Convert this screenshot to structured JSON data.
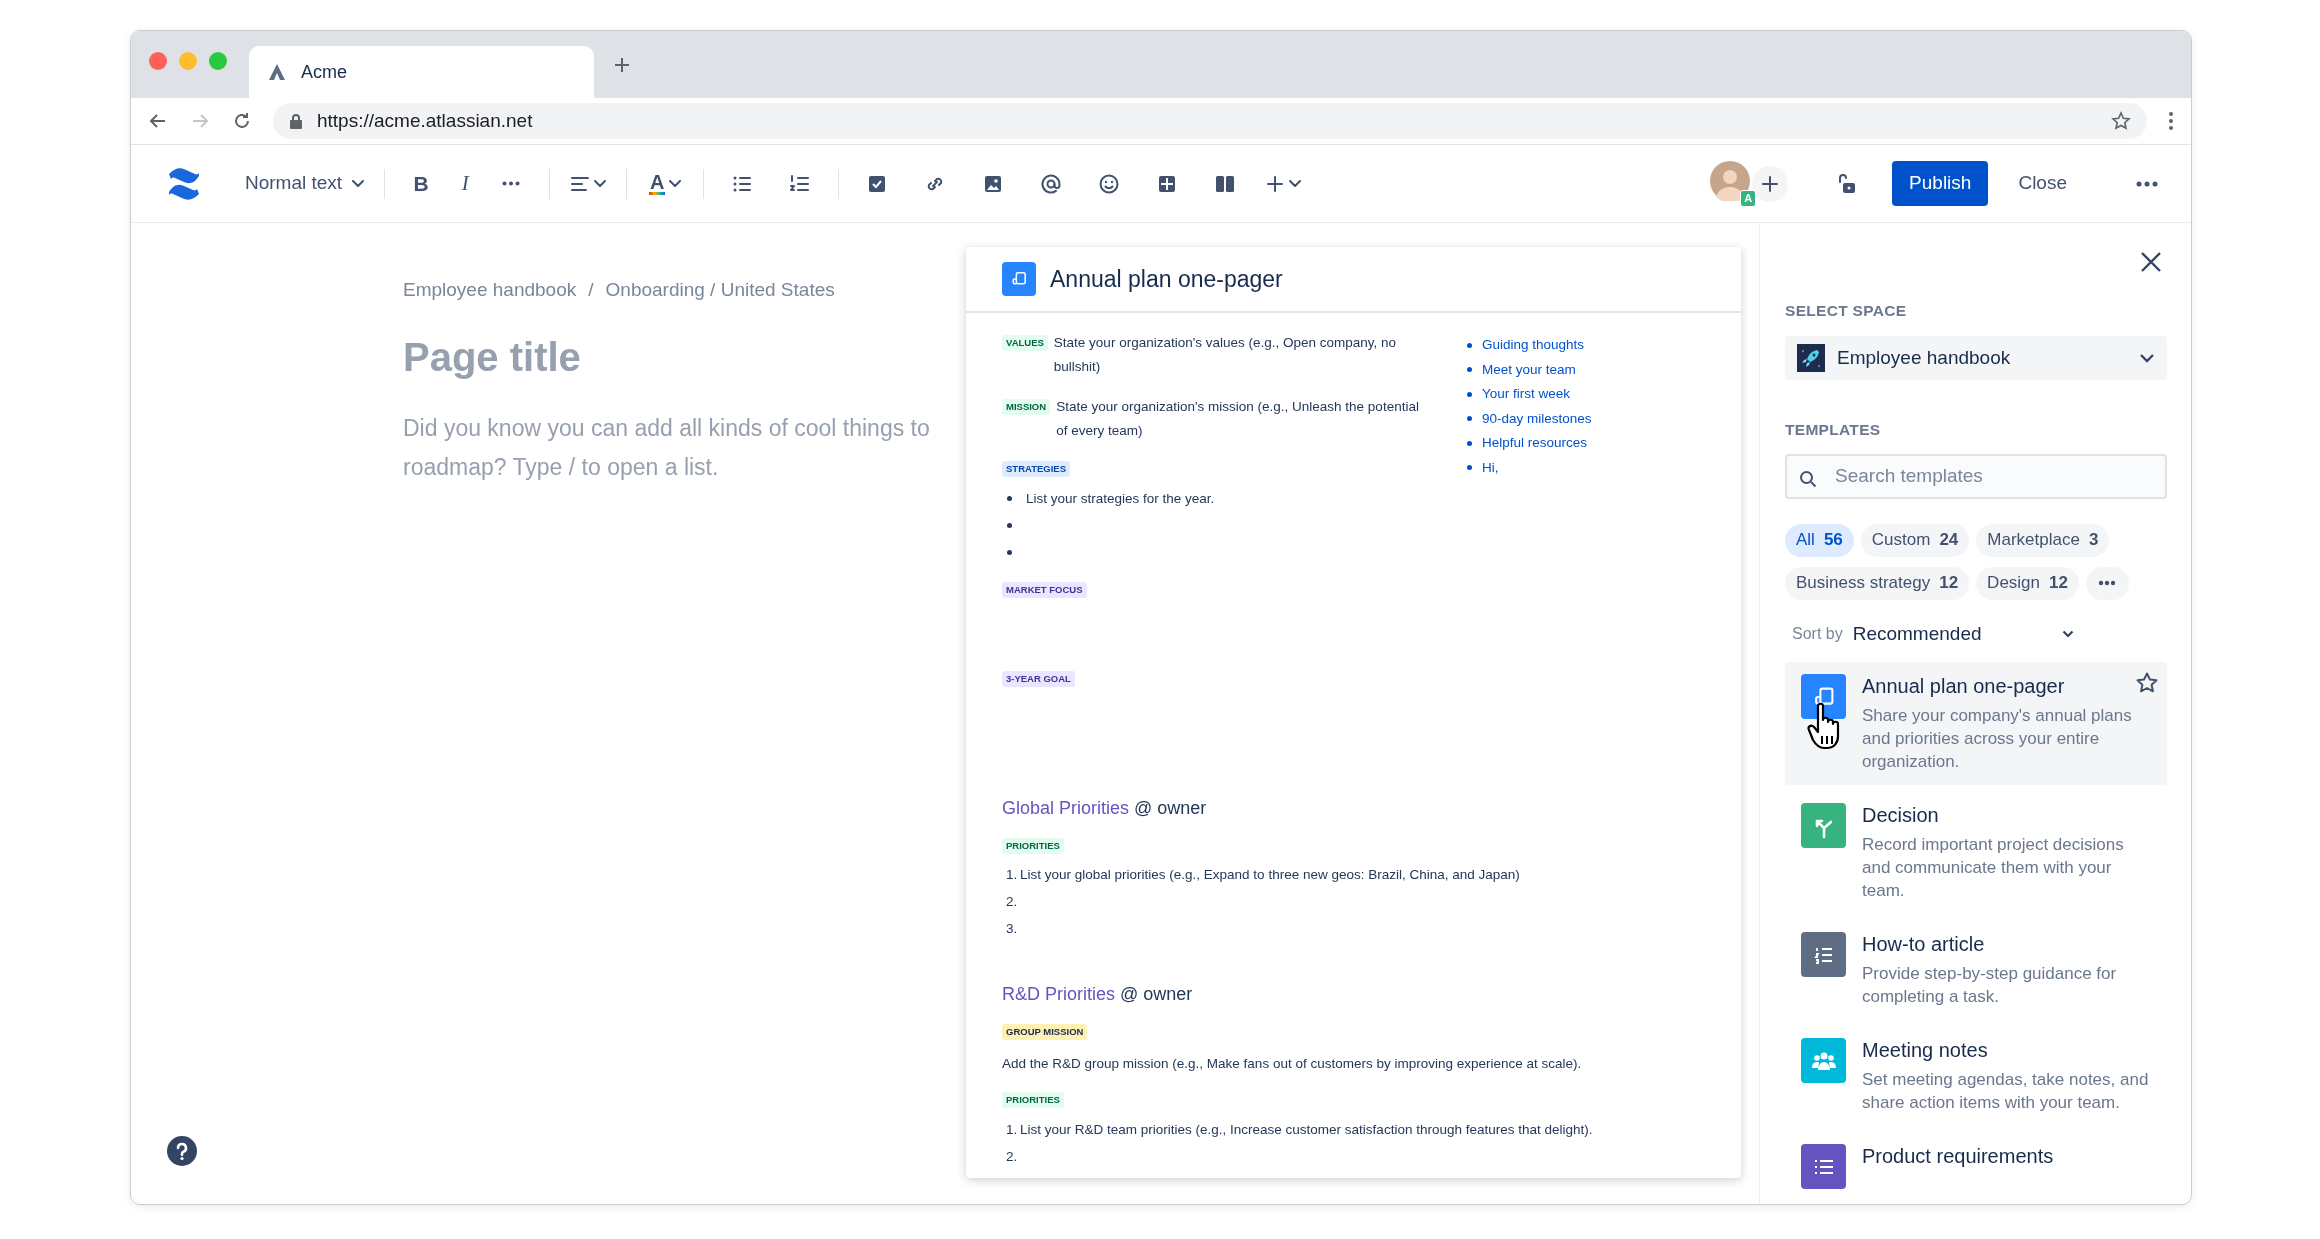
{
  "browser": {
    "tab_title": "Acme",
    "url": "https://acme.atlassian.net"
  },
  "toolbar": {
    "text_style": "Normal text",
    "format_marks": [
      "B",
      "I"
    ],
    "text_color_mark": "A",
    "avatar_badge": "A",
    "publish": "Publish",
    "close": "Close"
  },
  "editor": {
    "breadcrumb": [
      "Employee handbook",
      "Onboarding / United States"
    ],
    "breadcrumb_separator": "/",
    "title_placeholder": "Page title",
    "hint_lines": [
      "Did you know you can add all kinds of cool things to",
      "roadmap? Type / to open a list."
    ]
  },
  "preview": {
    "title": "Annual plan one-pager",
    "intro_blocks": [
      {
        "kind": "tagged",
        "tag": "VALUES",
        "color": "#e3fcef",
        "text": "State your organization's values (e.g., Open company, no bullshit)"
      },
      {
        "kind": "tagged",
        "tag": "MISSION",
        "color": "#e3fcef",
        "text": "State your organization's mission (e.g., Unleash the potential of every team)"
      },
      {
        "kind": "section",
        "tag": "STRATEGIES",
        "color": "#deebff",
        "items": [
          {
            "kind": "bullet",
            "text": "List your strategies for the year."
          },
          {
            "kind": "bullet"
          },
          {
            "kind": "bullet"
          }
        ]
      },
      {
        "kind": "section",
        "tag": "MARKET FOCUS",
        "color": "#eae6ff"
      },
      {
        "kind": "section",
        "tag": "3-YEAR GOAL",
        "color": "#eae6ff"
      }
    ],
    "links": [
      "Guiding thoughts",
      "Meet your team",
      "Your first week",
      "90-day milestones",
      "Helpful resources",
      "Hi,"
    ],
    "blocks": [
      {
        "kind": "heading",
        "title": "Global Priorities",
        "owner": "@ owner"
      },
      {
        "kind": "section",
        "tag": "PRIORITIES",
        "color": "#e3fcef",
        "items": [
          {
            "kind": "number",
            "number": "1.",
            "text": "List your global priorities (e.g., Expand to three new geos: Brazil, China, and Japan)"
          },
          {
            "kind": "number",
            "number": "2."
          },
          {
            "kind": "number",
            "number": "3."
          }
        ]
      },
      {
        "kind": "heading",
        "title": "R&D Priorities",
        "owner": "@ owner"
      },
      {
        "kind": "section",
        "tag": "GROUP MISSION",
        "color": "#fff0b3",
        "text": "Add the R&D group mission (e.g., Make fans out of customers by improving experience at scale)."
      },
      {
        "kind": "section",
        "tag": "PRIORITIES",
        "color": "#e3fcef",
        "items": [
          {
            "kind": "number",
            "number": "1.",
            "text": "List your R&D team priorities (e.g., Increase customer satisfaction through features that delight)."
          },
          {
            "kind": "number",
            "number": "2."
          }
        ]
      }
    ]
  },
  "sidebar": {
    "select_space_label": "SELECT SPACE",
    "space": "Employee handbook",
    "templates_label": "TEMPLATES",
    "search_placeholder": "Search templates",
    "filters": [
      {
        "label": "All",
        "count": "56",
        "selected": true
      },
      {
        "label": "Custom",
        "count": "24",
        "selected": false
      },
      {
        "label": "Marketplace",
        "count": "3",
        "selected": false
      },
      {
        "label": "Business strategy",
        "count": "12",
        "selected": false
      },
      {
        "label": "Design",
        "count": "12",
        "selected": false
      }
    ],
    "sort_label": "Sort by",
    "sort_value": "Recommended",
    "templates": [
      {
        "title": "Annual plan one-pager",
        "description": "Share your company's annual plans and priorities across your entire organization.",
        "color": "#2684ff",
        "hovered": true
      },
      {
        "title": "Decision",
        "description": "Record important project decisions and communicate them with your team.",
        "color": "#36b37e",
        "hovered": false
      },
      {
        "title": "How-to article",
        "description": "Provide step-by-step guidance for completing a task.",
        "color": "#5e6c84",
        "hovered": false
      },
      {
        "title": "Meeting notes",
        "description": "Set meeting agendas, take notes, and share action items with your team.",
        "color": "#00b8d9",
        "hovered": false
      },
      {
        "title": "Product requirements",
        "color": "#6554c0",
        "hovered": false
      }
    ]
  }
}
